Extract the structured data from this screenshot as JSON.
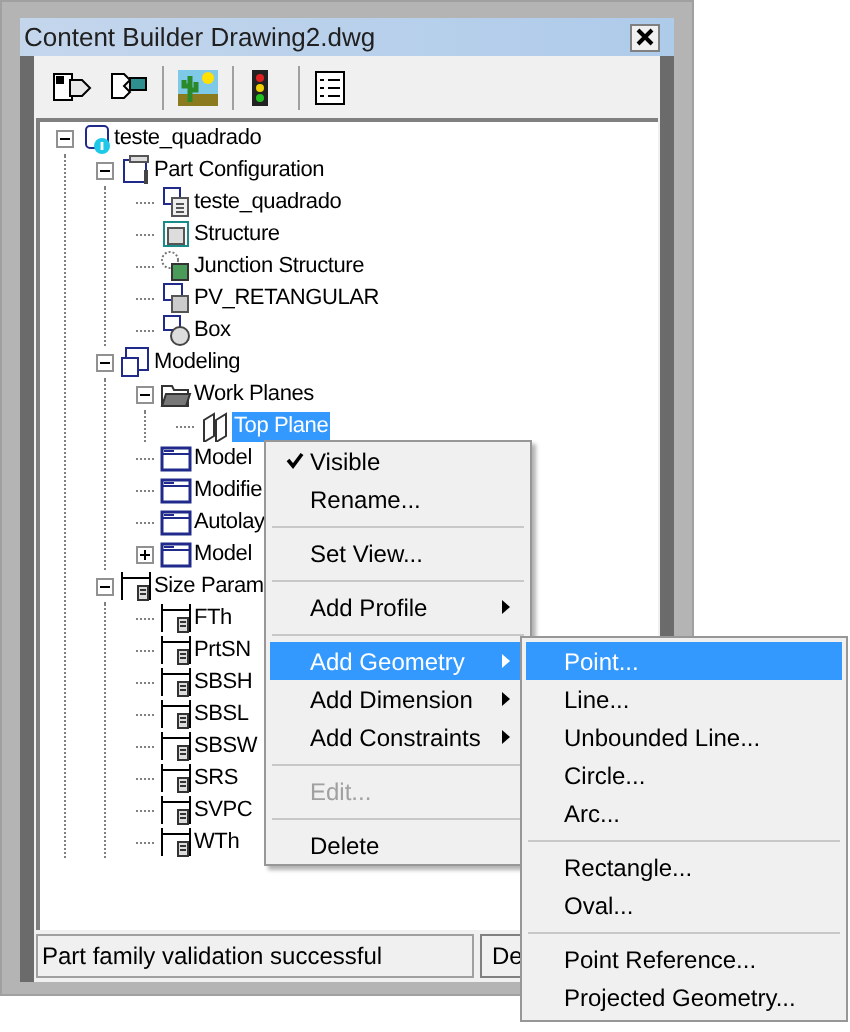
{
  "window": {
    "title": "Content Builder Drawing2.dwg"
  },
  "tree": [
    {
      "label": "teste_quadrado",
      "kind": "part",
      "expanded": true,
      "selected": false,
      "children": [
        {
          "label": "Part Configuration",
          "kind": "config",
          "expanded": true,
          "selected": false,
          "children": [
            {
              "label": "teste_quadrado",
              "kind": "document",
              "selected": false
            },
            {
              "label": "Structure",
              "kind": "structure",
              "selected": false
            },
            {
              "label": "Junction Structure",
              "kind": "junction",
              "selected": false
            },
            {
              "label": "PV_RETANGULAR",
              "kind": "pv",
              "selected": false
            },
            {
              "label": "Box",
              "kind": "box",
              "selected": false
            }
          ]
        },
        {
          "label": "Modeling",
          "kind": "modeling",
          "expanded": true,
          "selected": false,
          "children": [
            {
              "label": "Work Planes",
              "kind": "folder-open",
              "expanded": true,
              "selected": false,
              "children": [
                {
                  "label": "Top Plane",
                  "kind": "plane",
                  "selected": true
                }
              ]
            },
            {
              "label": "Model",
              "kind": "folder",
              "selected": false
            },
            {
              "label": "Modifie",
              "kind": "folder",
              "selected": false
            },
            {
              "label": "Autolay",
              "kind": "folder",
              "selected": false
            },
            {
              "label": "Model",
              "kind": "folder",
              "expanded": false,
              "selected": false
            }
          ]
        },
        {
          "label": "Size Param",
          "kind": "params",
          "expanded": true,
          "selected": false,
          "children": [
            {
              "label": "FTh",
              "kind": "param",
              "selected": false
            },
            {
              "label": "PrtSN",
              "kind": "param",
              "selected": false
            },
            {
              "label": "SBSH",
              "kind": "param",
              "selected": false
            },
            {
              "label": "SBSL",
              "kind": "param",
              "selected": false
            },
            {
              "label": "SBSW",
              "kind": "param",
              "selected": false
            },
            {
              "label": "SRS",
              "kind": "param",
              "selected": false
            },
            {
              "label": "SVPC",
              "kind": "param",
              "selected": false
            },
            {
              "label": "WTh",
              "kind": "param",
              "selected": false
            }
          ]
        }
      ]
    }
  ],
  "status_bar": {
    "text": "Part family validation successful",
    "button": "De"
  },
  "context_menu": [
    {
      "kind": "item",
      "label": "Visible",
      "checked": true,
      "disabled": false,
      "submenu": false,
      "selected": false
    },
    {
      "kind": "item",
      "label": "Rename...",
      "checked": false,
      "disabled": false,
      "submenu": false,
      "selected": false
    },
    {
      "kind": "separator"
    },
    {
      "kind": "item",
      "label": "Set View...",
      "checked": false,
      "disabled": false,
      "submenu": false,
      "selected": false
    },
    {
      "kind": "separator"
    },
    {
      "kind": "item",
      "label": "Add Profile",
      "checked": false,
      "disabled": false,
      "submenu": true,
      "selected": false
    },
    {
      "kind": "separator"
    },
    {
      "kind": "item",
      "label": "Add Geometry",
      "checked": false,
      "disabled": false,
      "submenu": true,
      "selected": true
    },
    {
      "kind": "item",
      "label": "Add Dimension",
      "checked": false,
      "disabled": false,
      "submenu": true,
      "selected": false
    },
    {
      "kind": "item",
      "label": "Add Constraints",
      "checked": false,
      "disabled": false,
      "submenu": true,
      "selected": false
    },
    {
      "kind": "separator"
    },
    {
      "kind": "item",
      "label": "Edit...",
      "checked": false,
      "disabled": true,
      "submenu": false,
      "selected": false
    },
    {
      "kind": "separator"
    },
    {
      "kind": "item",
      "label": "Delete",
      "checked": false,
      "disabled": false,
      "submenu": false,
      "selected": false
    }
  ],
  "submenu": [
    {
      "kind": "item",
      "label": "Point...",
      "selected": true
    },
    {
      "kind": "item",
      "label": "Line...",
      "selected": false
    },
    {
      "kind": "item",
      "label": "Unbounded Line...",
      "selected": false
    },
    {
      "kind": "item",
      "label": "Circle...",
      "selected": false
    },
    {
      "kind": "item",
      "label": "Arc...",
      "selected": false
    },
    {
      "kind": "separator"
    },
    {
      "kind": "item",
      "label": "Rectangle...",
      "selected": false
    },
    {
      "kind": "item",
      "label": "Oval...",
      "selected": false
    },
    {
      "kind": "separator"
    },
    {
      "kind": "item",
      "label": "Point Reference...",
      "selected": false
    },
    {
      "kind": "item",
      "label": "Projected Geometry...",
      "selected": false
    }
  ]
}
